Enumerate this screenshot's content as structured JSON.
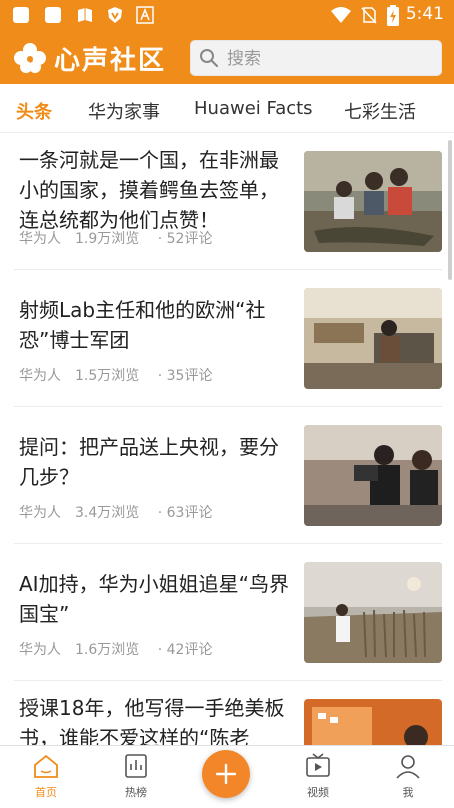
{
  "status_bar": {
    "time": "5:41",
    "icons": [
      "app-square-icon",
      "app-square-icon",
      "book-icon",
      "shield-icon",
      "font-icon",
      "wifi-icon",
      "no-sim-icon",
      "battery-charging-icon"
    ]
  },
  "header": {
    "title": "心声社区",
    "search_placeholder": "搜索",
    "accent_color": "#f08c1a"
  },
  "tabs": [
    {
      "label": "头条",
      "active": true
    },
    {
      "label": "华为家事",
      "active": false
    },
    {
      "label": "Huawei Facts",
      "active": false
    },
    {
      "label": "七彩生活",
      "active": false
    }
  ],
  "articles": [
    {
      "title": "一条河就是一个国，在非洲最小的国家，摸着鳄鱼去签单，连总统都为他们点赞！",
      "author": "华为人",
      "views": "1.9万浏览",
      "comments": "52评论"
    },
    {
      "title": "射频Lab主任和他的欧洲“社恐”博士军团",
      "author": "华为人",
      "views": "1.5万浏览",
      "comments": "35评论"
    },
    {
      "title": "提问：把产品送上央视，要分几步？",
      "author": "华为人",
      "views": "3.4万浏览",
      "comments": "63评论"
    },
    {
      "title": "AI加持，华为小姐姐追星“鸟界国宝”",
      "author": "华为人",
      "views": "1.6万浏览",
      "comments": "42评论"
    },
    {
      "title": "授课18年，他写得一手绝美板书，谁能不爱这样的“陈老",
      "author": "",
      "views": "",
      "comments": ""
    }
  ],
  "bottom_nav": {
    "home": "首页",
    "hot": "热榜",
    "video": "视频",
    "me": "我"
  }
}
